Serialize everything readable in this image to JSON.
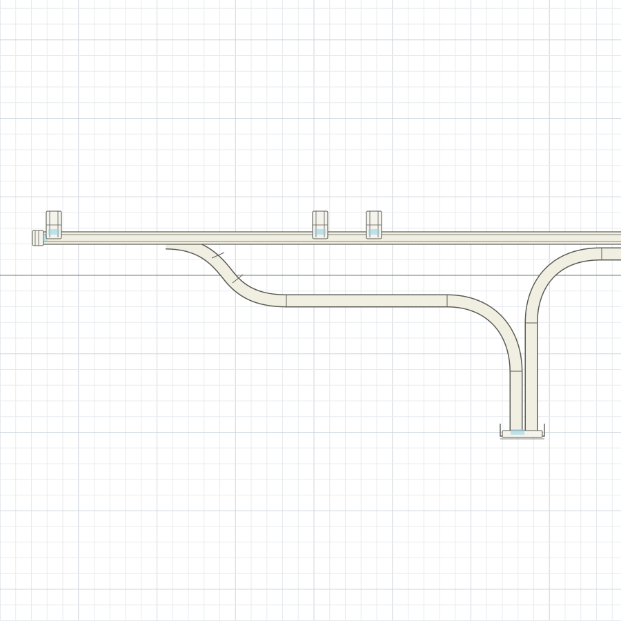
{
  "view": {
    "background": "#ffffff",
    "grid": {
      "visible": true,
      "minor_color": "#e7ebee",
      "major_color": "#cfd6dc",
      "axis_color": "#6f7478"
    }
  },
  "model": {
    "tube_fill": "#f1efe2",
    "tube_edge": "#5b5b55",
    "fitting_fill": "#f4f3ec",
    "fitting_accent": "#8fd0e8",
    "segments": {
      "main_rail": "main-rail-tube",
      "upper_branch": "upper-branch-tube",
      "lower_branch": "lower-branch-tube"
    },
    "fittings": [
      {
        "name": "left-end-cap",
        "kind": "end-cap"
      },
      {
        "name": "clip-1",
        "kind": "clip"
      },
      {
        "name": "clip-2",
        "kind": "clip"
      },
      {
        "name": "clip-3",
        "kind": "clip"
      },
      {
        "name": "bottom-bracket",
        "kind": "bracket"
      }
    ]
  }
}
